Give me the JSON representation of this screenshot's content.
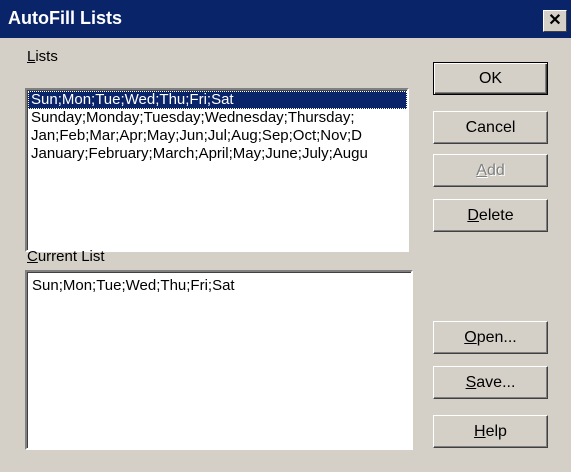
{
  "window": {
    "title": "AutoFill Lists",
    "close_glyph": "✕"
  },
  "lists": {
    "label_mnemonic": "L",
    "label_rest": "ists",
    "items": [
      "Sun;Mon;Tue;Wed;Thu;Fri;Sat",
      "Sunday;Monday;Tuesday;Wednesday;Thursday;",
      "Jan;Feb;Mar;Apr;May;Jun;Jul;Aug;Sep;Oct;Nov;D",
      "January;February;March;April;May;June;July;Augu"
    ],
    "selected_index": 0
  },
  "current_list": {
    "label_mnemonic": "C",
    "label_rest": "urrent List",
    "value": "Sun;Mon;Tue;Wed;Thu;Fri;Sat"
  },
  "buttons": {
    "ok": "OK",
    "cancel": "Cancel",
    "add_mnemonic": "A",
    "add_rest": "dd",
    "delete_mnemonic": "D",
    "delete_rest": "elete",
    "open_mnemonic": "O",
    "open_rest": "pen...",
    "save_mnemonic": "S",
    "save_rest": "ave...",
    "help_mnemonic": "H",
    "help_rest": "elp"
  },
  "colors": {
    "face": "#d4d0c8",
    "titlebar": "#0a246a",
    "selection": "#0a246a"
  }
}
